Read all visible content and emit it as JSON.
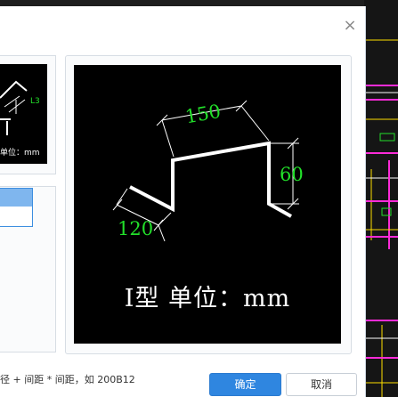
{
  "preview": {
    "caption": "I型  单位：mm",
    "dims": [
      "150",
      "60",
      "120"
    ]
  },
  "left_thumb": {
    "dim_label": "L3",
    "caption": "单位：mm"
  },
  "footer": {
    "hint": "径 + 间距 * 间距，如 200B12",
    "ok_label": "确定",
    "cancel_label": "取消"
  },
  "close_symbol": "×",
  "colors": {
    "accent": "#2f86e0",
    "dimension": "#22e02a",
    "preview_bg": "#000000"
  }
}
